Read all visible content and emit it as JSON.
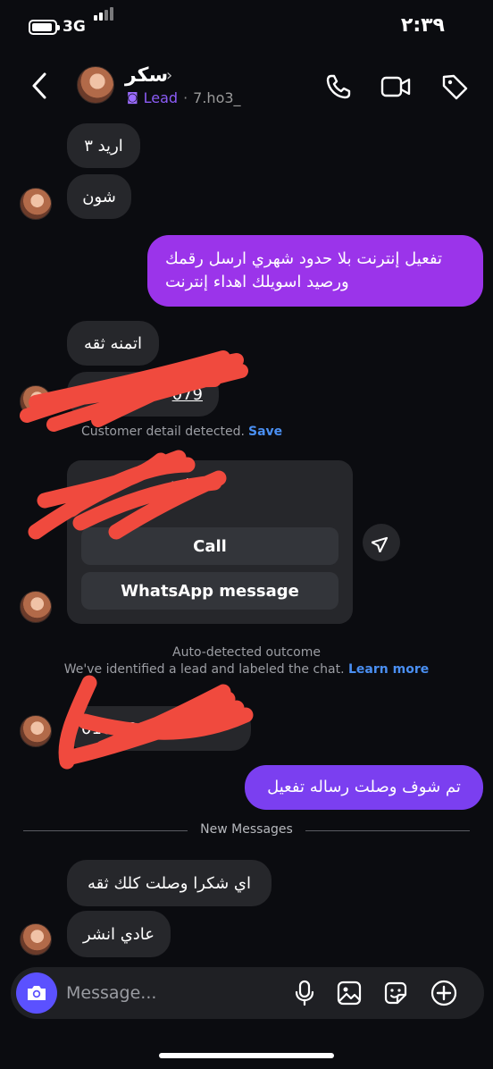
{
  "status_bar": {
    "network": "3G",
    "time": "٢:٣٩"
  },
  "header": {
    "contact_name": "سكر",
    "chevron": "›",
    "lead_label": "Lead",
    "separator": "·",
    "username": "7.ho3_"
  },
  "messages": {
    "received_1": "اريد ٣",
    "received_2": "شون",
    "sent_1_line1": "تفعيل إنترنت بلا حدود شهري ارسل رقمك",
    "sent_1_line2": "ورصيد اسويلك اهداء إنترنت",
    "received_3": "اتمنه ثقه",
    "received_4_redacted": "079",
    "detected_text": "Customer detail detected.",
    "detected_save": "Save",
    "contact_card_title_redacted": "mbe",
    "call_button": "Call",
    "whatsapp_button": "WhatsApp message",
    "outcome_title": "Auto-detected outcome",
    "outcome_text": "We've identified a lead and labeled the chat.",
    "outcome_link": "Learn more",
    "received_5_redacted": "010 009 2",
    "sent_2": "تم شوف وصلت رساله تفعيل",
    "new_messages": "New Messages",
    "received_6": "اي شكرا وصلت كلك ثقه",
    "received_7": "عادي انشر"
  },
  "composer": {
    "placeholder": "Message..."
  },
  "colors": {
    "background": "#0b0c10",
    "received_bubble": "#26272b",
    "sent_bubble": "#9b34ea",
    "accent_lead": "#8c5cf7",
    "link": "#4a8ff2",
    "camera_button": "#5b51ff",
    "redaction": "#f04a3e"
  }
}
